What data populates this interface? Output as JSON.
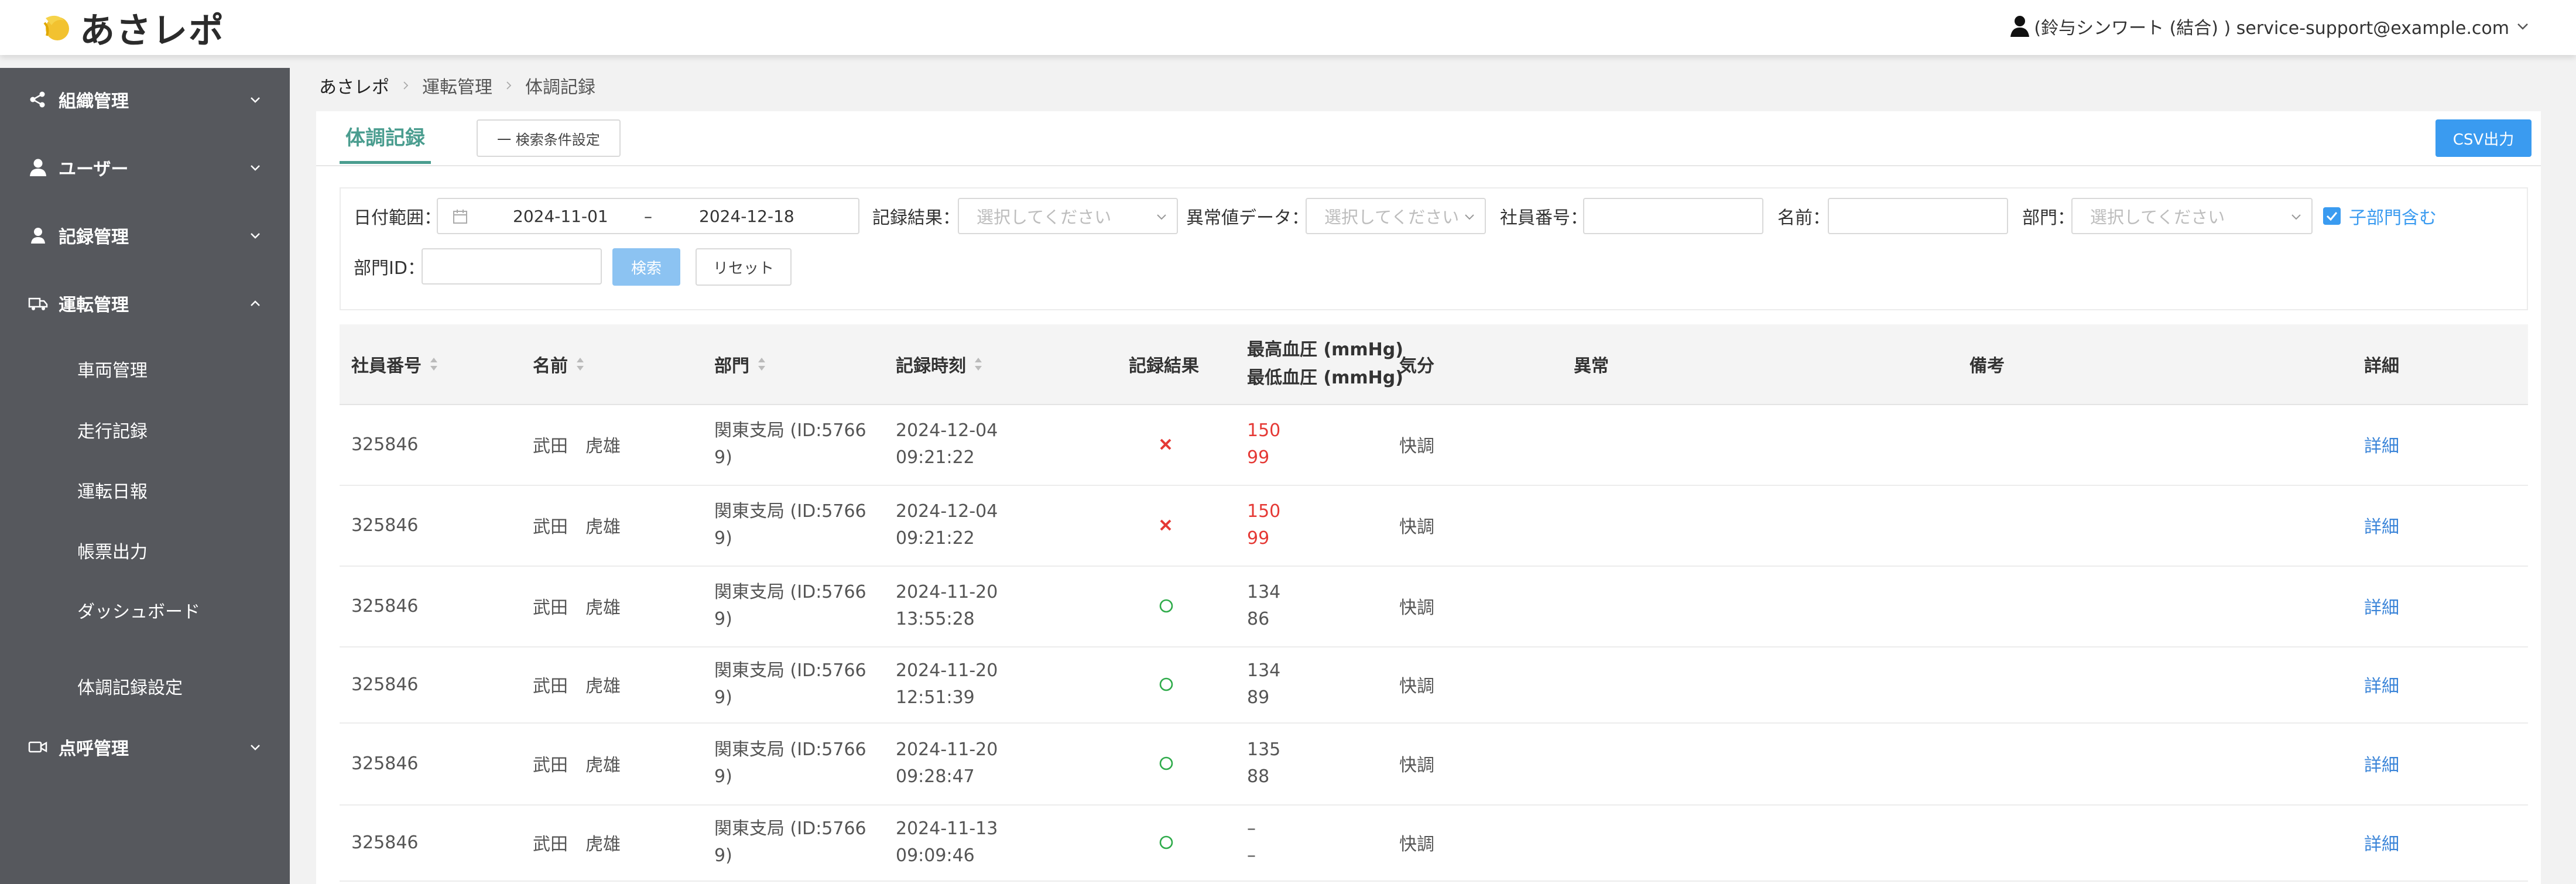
{
  "app": {
    "title": "あさレポ"
  },
  "header": {
    "user_label": "(鈴与シンワート (結合) ) service-support@example.com"
  },
  "sidebar": {
    "items": [
      {
        "label": "組織管理",
        "icon": "share-icon",
        "expanded": false
      },
      {
        "label": "ユーザー",
        "icon": "user-icon",
        "expanded": false
      },
      {
        "label": "記録管理",
        "icon": "record-user-icon",
        "expanded": false
      },
      {
        "label": "運転管理",
        "icon": "truck-icon",
        "expanded": true
      },
      {
        "label": "点呼管理",
        "icon": "video-icon",
        "expanded": false
      }
    ],
    "sub_items": [
      {
        "label": "車両管理"
      },
      {
        "label": "走行記録"
      },
      {
        "label": "運転日報"
      },
      {
        "label": "帳票出力"
      },
      {
        "label": "ダッシュボード"
      },
      {
        "label": "体調記録設定"
      }
    ]
  },
  "breadcrumb": [
    "あさレポ",
    "運転管理",
    "体調記録"
  ],
  "tabs": {
    "active": "体調記録"
  },
  "toolbar": {
    "search_conditions_label": "一 検索条件設定",
    "csv_label": "CSV出力"
  },
  "filters": {
    "date_range_label": "日付範囲：",
    "date_from": "2024-11-01",
    "date_sep": "–",
    "date_to": "2024-12-18",
    "record_result_label": "記録結果：",
    "record_result_placeholder": "選択してください",
    "abnormal_label": "異常値データ：",
    "abnormal_placeholder": "選択してください",
    "employee_no_label": "社員番号：",
    "name_label": "名前：",
    "dept_label": "部門：",
    "dept_placeholder": "選択してください",
    "include_children_label": "子部門含む",
    "include_children_checked": true,
    "dept_id_label": "部門ID：",
    "search_label": "検索",
    "reset_label": "リセット"
  },
  "table": {
    "columns": {
      "employee_no": "社員番号",
      "name": "名前",
      "dept": "部門",
      "recorded_at": "記録時刻",
      "result": "記録結果",
      "bp_high": "最高血圧 (mmHg)",
      "bp_low": "最低血圧 (mmHg)",
      "mood": "気分",
      "abnormal": "異常",
      "remarks": "備考",
      "detail": "詳細"
    },
    "rows": [
      {
        "employee_no": "325846",
        "name": "武田　虎雄",
        "dept_l1": "関東支局 (ID:5766",
        "dept_l2": "9)",
        "date": "2024-12-04",
        "time": "09:21:22",
        "result": "ng",
        "bp_high": "150",
        "bp_low": "99",
        "bp_alert": true,
        "mood": "快調",
        "detail": "詳細"
      },
      {
        "employee_no": "325846",
        "name": "武田　虎雄",
        "dept_l1": "関東支局 (ID:5766",
        "dept_l2": "9)",
        "date": "2024-12-04",
        "time": "09:21:22",
        "result": "ng",
        "bp_high": "150",
        "bp_low": "99",
        "bp_alert": true,
        "mood": "快調",
        "detail": "詳細"
      },
      {
        "employee_no": "325846",
        "name": "武田　虎雄",
        "dept_l1": "関東支局 (ID:5766",
        "dept_l2": "9)",
        "date": "2024-11-20",
        "time": "13:55:28",
        "result": "ok",
        "bp_high": "134",
        "bp_low": "86",
        "bp_alert": false,
        "mood": "快調",
        "detail": "詳細"
      },
      {
        "employee_no": "325846",
        "name": "武田　虎雄",
        "dept_l1": "関東支局 (ID:5766",
        "dept_l2": "9)",
        "date": "2024-11-20",
        "time": "12:51:39",
        "result": "ok",
        "bp_high": "134",
        "bp_low": "89",
        "bp_alert": false,
        "mood": "快調",
        "detail": "詳細"
      },
      {
        "employee_no": "325846",
        "name": "武田　虎雄",
        "dept_l1": "関東支局 (ID:5766",
        "dept_l2": "9)",
        "date": "2024-11-20",
        "time": "09:28:47",
        "result": "ok",
        "bp_high": "135",
        "bp_low": "88",
        "bp_alert": false,
        "mood": "快調",
        "detail": "詳細"
      },
      {
        "employee_no": "325846",
        "name": "武田　虎雄",
        "dept_l1": "関東支局 (ID:5766",
        "dept_l2": "9)",
        "date": "2024-11-13",
        "time": "09:09:46",
        "result": "ok",
        "bp_high": "–",
        "bp_low": "–",
        "bp_alert": false,
        "mood": "快調",
        "detail": "詳細"
      }
    ]
  },
  "colors": {
    "accent": "#4a9d8f",
    "primary": "#3a9bf0",
    "sidebar_bg": "#56585d",
    "alert": "#e53935",
    "ok": "#2eab4a"
  }
}
